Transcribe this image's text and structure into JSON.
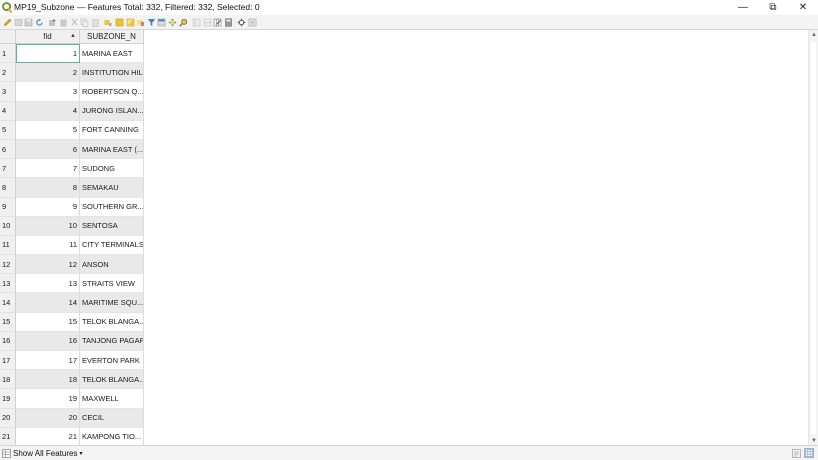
{
  "window": {
    "title": "MP19_Subzone — Features Total: 332, Filtered: 332, Selected: 0",
    "min_glyph": "—",
    "max_glyph": "⧉",
    "close_glyph": "✕"
  },
  "toolbar": {
    "icons": [
      "pencil-icon",
      "multi-edit-icon",
      "save-edits-icon",
      "reload-icon",
      "add-feature-icon",
      "delete-feature-icon",
      "cut-icon",
      "copy-icon",
      "paste-icon",
      "expression-select-icon",
      "select-all-icon",
      "invert-selection-icon",
      "deselect-icon",
      "filter-map-icon",
      "move-selection-top-icon",
      "pan-to-selection-icon",
      "zoom-to-selection-icon",
      "new-field-icon",
      "delete-field-icon",
      "organize-columns-icon",
      "field-calculator-icon",
      "conditional-format-icon",
      "actions-icon",
      "dock-icon"
    ]
  },
  "table": {
    "columns": [
      "fid",
      "SUBZONE_N"
    ],
    "sort_glyph": "▲",
    "rows": [
      {
        "n": "1",
        "fid": "1",
        "name": "MARINA EAST"
      },
      {
        "n": "2",
        "fid": "2",
        "name": "INSTITUTION HILL"
      },
      {
        "n": "3",
        "fid": "3",
        "name": "ROBERTSON Q..."
      },
      {
        "n": "4",
        "fid": "4",
        "name": "JURONG ISLAN..."
      },
      {
        "n": "5",
        "fid": "5",
        "name": "FORT CANNING"
      },
      {
        "n": "6",
        "fid": "6",
        "name": "MARINA EAST (..."
      },
      {
        "n": "7",
        "fid": "7",
        "name": "SUDONG"
      },
      {
        "n": "8",
        "fid": "8",
        "name": "SEMAKAU"
      },
      {
        "n": "9",
        "fid": "9",
        "name": "SOUTHERN GR..."
      },
      {
        "n": "10",
        "fid": "10",
        "name": "SENTOSA"
      },
      {
        "n": "11",
        "fid": "11",
        "name": "CITY TERMINALS"
      },
      {
        "n": "12",
        "fid": "12",
        "name": "ANSON"
      },
      {
        "n": "13",
        "fid": "13",
        "name": "STRAITS VIEW"
      },
      {
        "n": "14",
        "fid": "14",
        "name": "MARITIME SQU..."
      },
      {
        "n": "15",
        "fid": "15",
        "name": "TELOK BLANGA..."
      },
      {
        "n": "16",
        "fid": "16",
        "name": "TANJONG PAGAR"
      },
      {
        "n": "17",
        "fid": "17",
        "name": "EVERTON PARK"
      },
      {
        "n": "18",
        "fid": "18",
        "name": "TELOK BLANGA..."
      },
      {
        "n": "19",
        "fid": "19",
        "name": "MAXWELL"
      },
      {
        "n": "20",
        "fid": "20",
        "name": "CECIL"
      },
      {
        "n": "21",
        "fid": "21",
        "name": "KAMPONG TIO..."
      }
    ]
  },
  "statusbar": {
    "show_all_label": "Show All Features",
    "caret_glyph": "▾"
  },
  "colors": {
    "accent": "#5fb0a4",
    "qgis_green": "#589632",
    "qgis_yellow": "#ee9b1f"
  }
}
